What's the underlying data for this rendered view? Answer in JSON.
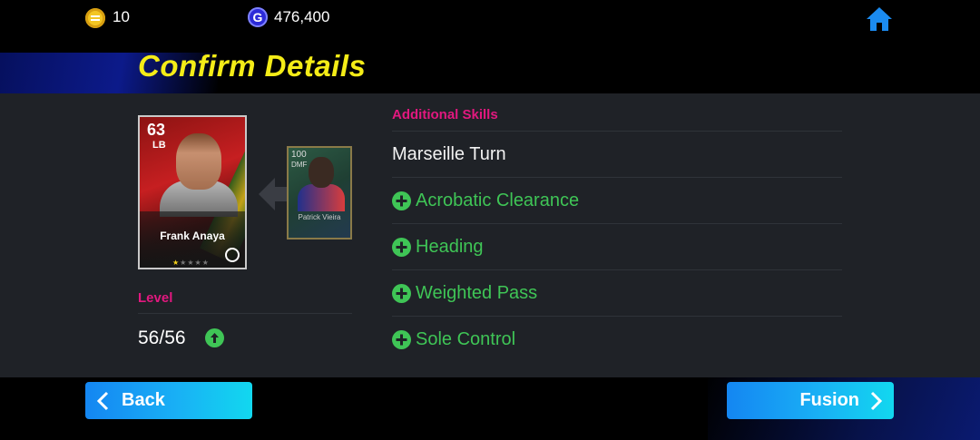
{
  "topbar": {
    "coins_icon": "coin-icon",
    "coins": "10",
    "gp_icon": "gp-icon",
    "gp_letter": "G",
    "gp": "476,400",
    "home_icon": "home-icon"
  },
  "page_title": "Confirm Details",
  "player_card": {
    "rating": "63",
    "position": "LB",
    "name": "Frank Anaya",
    "stars_total": 5,
    "stars_filled": 1
  },
  "material_card": {
    "rating": "100",
    "position": "DMF",
    "name": "Patrick Vieira"
  },
  "level": {
    "label": "Level",
    "value": "56/56",
    "icon": "arrow-up-circle-icon"
  },
  "skills": {
    "title": "Additional Skills",
    "items": [
      {
        "label": "Marseille Turn",
        "new": false
      },
      {
        "label": "Acrobatic Clearance",
        "new": true
      },
      {
        "label": "Heading",
        "new": true
      },
      {
        "label": "Weighted Pass",
        "new": true
      },
      {
        "label": "Sole Control",
        "new": true
      }
    ]
  },
  "buttons": {
    "back": "Back",
    "fusion": "Fusion"
  },
  "colors": {
    "title_yellow": "#f4ec17",
    "accent_pink": "#e2187f",
    "new_skill_green": "#3fc556",
    "panel_bg": "#1f2227",
    "button_blue": "#1486f2"
  }
}
